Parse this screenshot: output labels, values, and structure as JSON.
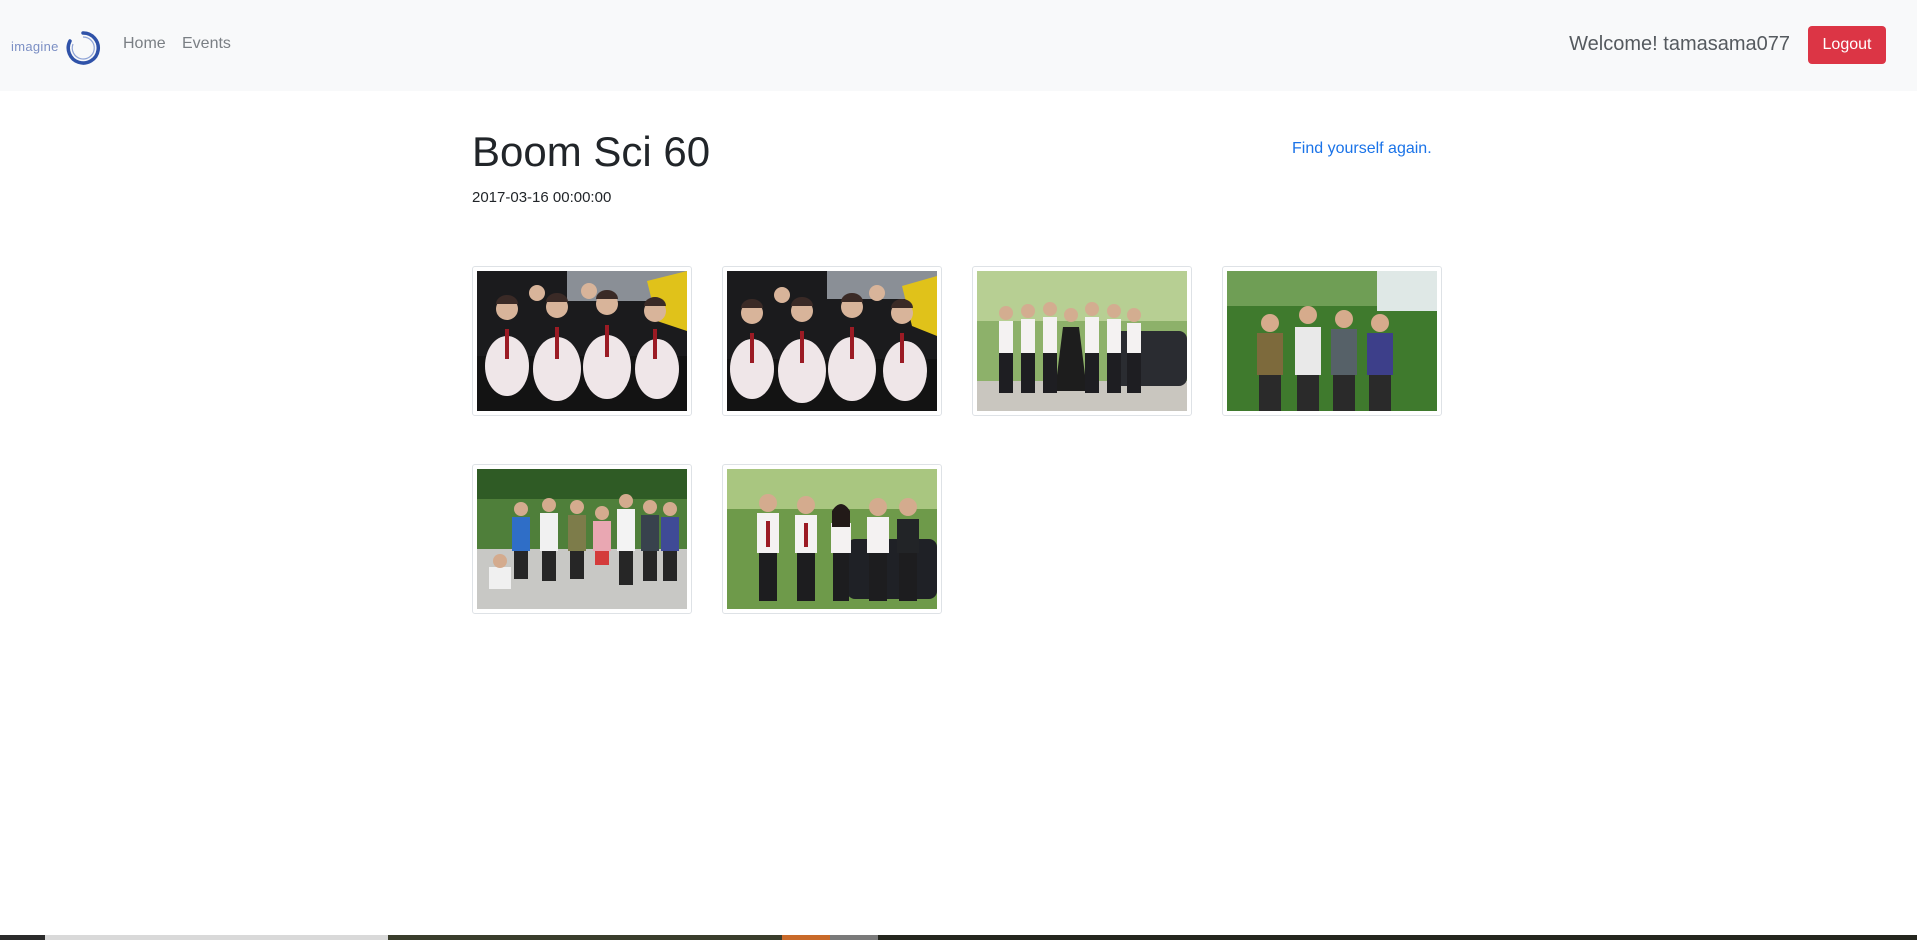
{
  "nav": {
    "brand_text": "imagine",
    "home_label": "Home",
    "events_label": "Events",
    "welcome_text": "Welcome! tamasama077",
    "logout_label": "Logout"
  },
  "event": {
    "title": "Boom Sci 60",
    "date": "2017-03-16 00:00:00",
    "find_link": "Find yourself again."
  },
  "colors": {
    "navbar_bg": "#f8f9fa",
    "logout_bg": "#dc3545",
    "link": "#1a73e8",
    "brand_ring": "#2f52a8"
  },
  "photos": [
    {
      "scene": "indoor-seated-group"
    },
    {
      "scene": "indoor-seated-group"
    },
    {
      "scene": "outdoor-standing-group-car"
    },
    {
      "scene": "outdoor-casual-group-trees"
    },
    {
      "scene": "outdoor-casual-group-lot"
    },
    {
      "scene": "outdoor-standing-group-car"
    }
  ]
}
